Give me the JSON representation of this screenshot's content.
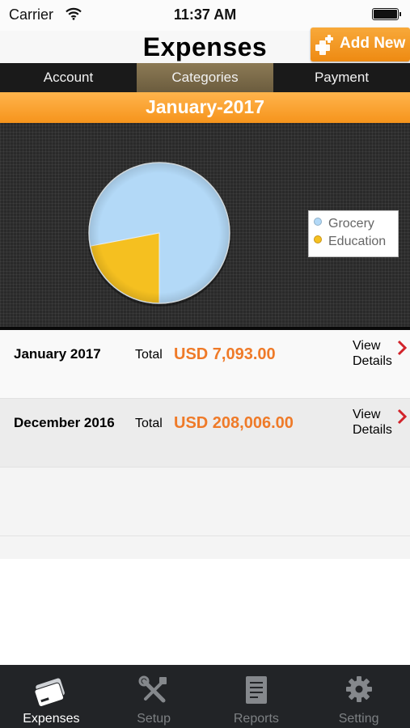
{
  "status_bar": {
    "carrier": "Carrier",
    "time": "11:37 AM"
  },
  "nav": {
    "title": "Expenses",
    "add_label": "Add New"
  },
  "segments": [
    {
      "label": "Account",
      "active": false
    },
    {
      "label": "Categories",
      "active": true
    },
    {
      "label": "Payment",
      "active": false
    }
  ],
  "month_header": "January-2017",
  "chart_data": {
    "type": "pie",
    "labels": [
      "Grocery",
      "Education"
    ],
    "values": [
      78,
      22
    ],
    "colors": [
      "#b3d9f7",
      "#f5c020"
    ],
    "legend_position": "right"
  },
  "rows": [
    {
      "month": "January 2017",
      "total_label": "Total",
      "amount": "USD 7,093.00",
      "view_label": "View Details"
    },
    {
      "month": "December 2016",
      "total_label": "Total",
      "amount": "USD 208,006.00",
      "view_label": "View Details"
    }
  ],
  "tabs": [
    {
      "label": "Expenses",
      "icon": "cards-icon",
      "active": true
    },
    {
      "label": "Setup",
      "icon": "tools-icon",
      "active": false
    },
    {
      "label": "Reports",
      "icon": "report-icon",
      "active": false
    },
    {
      "label": "Setting",
      "icon": "gear-icon",
      "active": false
    }
  ],
  "colors": {
    "accent_orange": "#f6941c",
    "amount_orange": "#ef7a28",
    "tab_bar": "#222427"
  }
}
